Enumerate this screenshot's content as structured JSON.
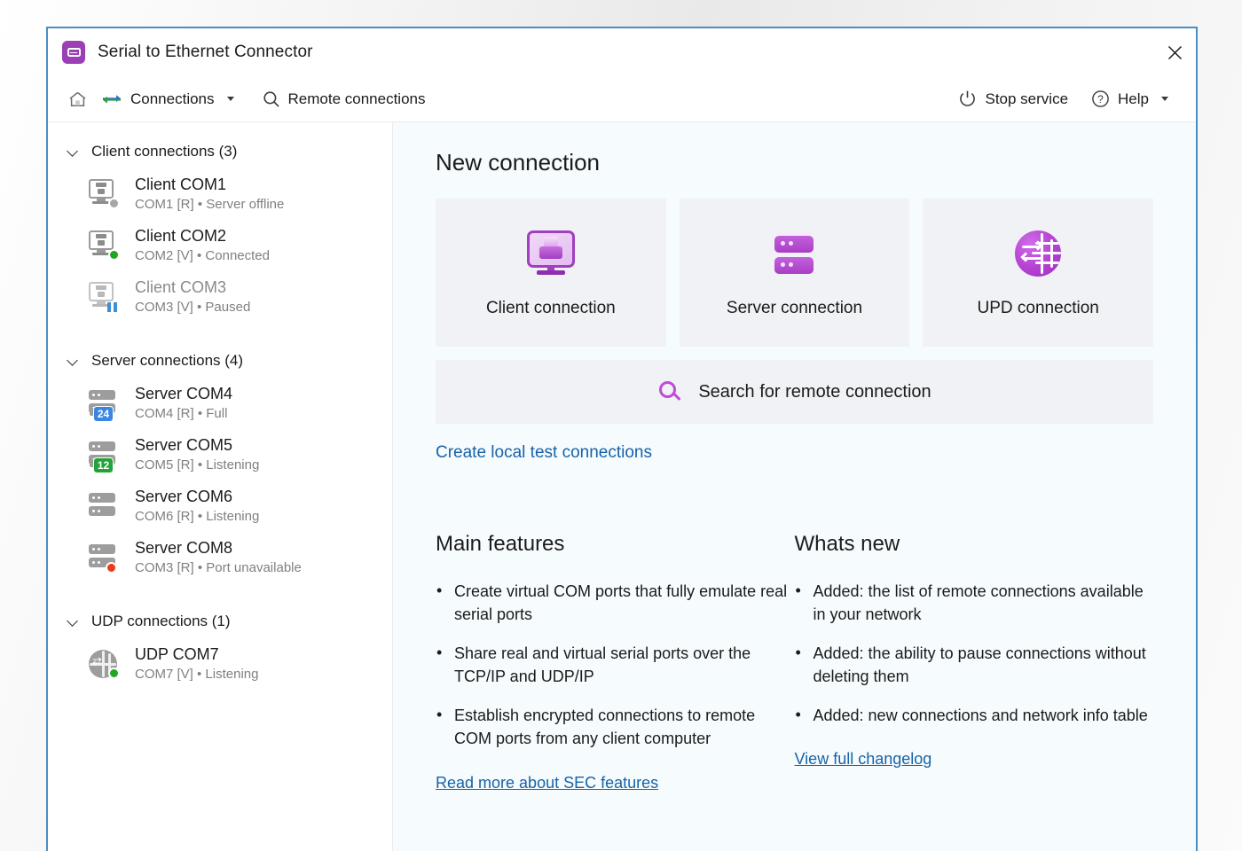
{
  "window": {
    "title": "Serial to Ethernet Connector",
    "app_icon": "serial-connector-icon",
    "close_icon": "close-icon"
  },
  "toolbar": {
    "home_icon": "home-icon",
    "connections_label": "Connections",
    "connections_icon": "transfer-arrows-icon",
    "remote_connections_label": "Remote connections",
    "remote_connections_icon": "search-icon",
    "stop_service_label": "Stop service",
    "stop_service_icon": "power-icon",
    "help_label": "Help",
    "help_icon": "question-circle-icon"
  },
  "sidebar": {
    "groups": [
      {
        "title": "Client connections (3)",
        "icon": "chevron-down-icon",
        "items": [
          {
            "name": "Client COM1",
            "sub": "COM1 [R] • Server offline",
            "icon": "client-monitor-icon",
            "status": "offline",
            "status_color": "#a6a6a6",
            "dimmed": false
          },
          {
            "name": "Client COM2",
            "sub": "COM2 [V] • Connected",
            "icon": "client-monitor-icon",
            "status": "connected",
            "status_color": "#21a621",
            "dimmed": false
          },
          {
            "name": "Client COM3",
            "sub": "COM3 [V] • Paused",
            "icon": "client-monitor-icon",
            "status": "paused",
            "status_color": "#3f8fd6",
            "dimmed": true
          }
        ]
      },
      {
        "title": "Server connections (4)",
        "icon": "chevron-down-icon",
        "items": [
          {
            "name": "Server COM4",
            "sub": "COM4 [R] • Full",
            "icon": "server-rack-icon",
            "badge": "24",
            "badge_color": "#3a86e0",
            "dimmed": false
          },
          {
            "name": "Server COM5",
            "sub": "COM5 [R] • Listening",
            "icon": "server-rack-icon",
            "badge": "12",
            "badge_color": "#23a23a",
            "dimmed": false
          },
          {
            "name": "Server COM6",
            "sub": "COM6 [R] • Listening",
            "icon": "server-rack-icon",
            "dimmed": false
          },
          {
            "name": "Server COM8",
            "sub": "COM3 [R] • Port unavailable",
            "icon": "server-rack-icon",
            "status": "error",
            "status_color": "#ec3a17",
            "dimmed": false
          }
        ]
      },
      {
        "title": "UDP connections (1)",
        "icon": "chevron-down-icon",
        "items": [
          {
            "name": "UDP COM7",
            "sub": "COM7 [V] • Listening",
            "icon": "udp-globe-icon",
            "status": "listening",
            "status_color": "#21a621",
            "dimmed": false
          }
        ]
      }
    ]
  },
  "main": {
    "heading": "New connection",
    "cards": [
      {
        "label": "Client connection",
        "icon": "client-connection-icon"
      },
      {
        "label": "Server connection",
        "icon": "server-connection-icon"
      },
      {
        "label": "UPD connection",
        "icon": "udp-connection-icon"
      }
    ],
    "search_banner": {
      "label": "Search for remote connection",
      "icon": "search-icon"
    },
    "create_test_link": "Create local test connections",
    "features": {
      "heading": "Main features",
      "items": [
        "Create virtual COM ports that fully emulate real serial ports",
        "Share real and virtual serial ports over the TCP/IP and UDP/IP",
        "Establish encrypted connections to remote COM ports from any client computer"
      ],
      "link": "Read more about SEC features"
    },
    "whatsnew": {
      "heading": "Whats new",
      "items": [
        "Added: the list of remote connections available in your network",
        "Added: the ability to pause connections without deleting them",
        "Added: new connections and network info table"
      ],
      "link": "View full changelog"
    }
  },
  "colors": {
    "brand_purple": "#9b3fb5",
    "link_blue": "#1763a8",
    "window_border": "#4a8ec2",
    "main_bg": "#f6fbfd"
  }
}
